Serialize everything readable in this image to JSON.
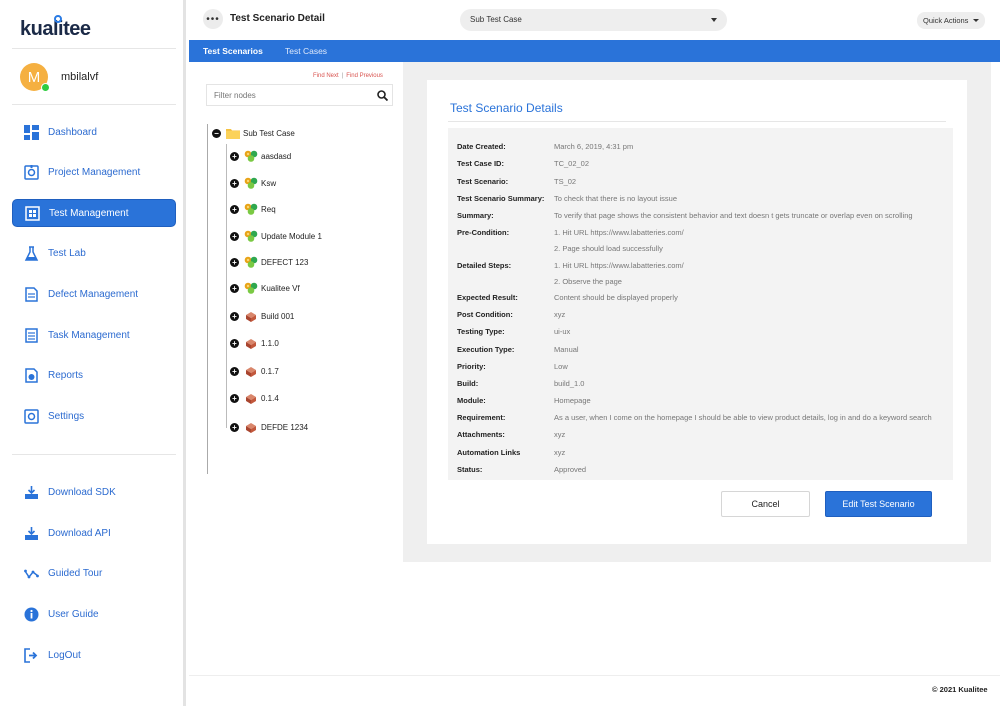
{
  "brand": {
    "logo_text": "kualitee",
    "accent": "#2a73d9"
  },
  "user": {
    "initial": "M",
    "name": "mbilalvf"
  },
  "sidebar": {
    "items": [
      {
        "label": "Dashboard",
        "icon": "dashboard-icon"
      },
      {
        "label": "Project Management",
        "icon": "project-icon"
      },
      {
        "label": "Test Management",
        "icon": "test-management-icon",
        "active": true
      },
      {
        "label": "Test Lab",
        "icon": "flask-icon"
      },
      {
        "label": "Defect Management",
        "icon": "defect-icon"
      },
      {
        "label": "Task Management",
        "icon": "task-icon"
      },
      {
        "label": "Reports",
        "icon": "reports-icon"
      },
      {
        "label": "Settings",
        "icon": "settings-icon"
      }
    ],
    "secondary": [
      {
        "label": "Download SDK",
        "icon": "download-sdk-icon"
      },
      {
        "label": "Download API",
        "icon": "download-api-icon"
      },
      {
        "label": "Guided Tour",
        "icon": "tour-icon"
      },
      {
        "label": "User Guide",
        "icon": "info-icon"
      },
      {
        "label": "LogOut",
        "icon": "logout-icon"
      }
    ]
  },
  "header": {
    "menu_glyph": "•••",
    "title": "Test Scenario Detail",
    "selector_value": "Sub Test Case",
    "quick_actions": "Quick Actions"
  },
  "tabs": [
    {
      "label": "Test Scenarios",
      "active": true
    },
    {
      "label": "Test Cases",
      "active": false
    }
  ],
  "tree": {
    "find_next": "Find Next",
    "find_prev": "Find Previous",
    "filter_placeholder": "Filter nodes",
    "root": "Sub Test Case",
    "nodes": [
      {
        "label": "aasdasd",
        "kind": "module"
      },
      {
        "label": "Ksw",
        "kind": "module"
      },
      {
        "label": "Req",
        "kind": "module"
      },
      {
        "label": "Update Module 1",
        "kind": "module"
      },
      {
        "label": "DEFECT 123",
        "kind": "module"
      },
      {
        "label": "Kualitee Vf",
        "kind": "module"
      },
      {
        "label": "Build 001",
        "kind": "build"
      },
      {
        "label": "1.1.0",
        "kind": "build"
      },
      {
        "label": "0.1.7",
        "kind": "build"
      },
      {
        "label": "0.1.4",
        "kind": "build"
      },
      {
        "label": "DEFDE 1234",
        "kind": "build"
      }
    ]
  },
  "details": {
    "title": "Test Scenario Details",
    "rows": [
      {
        "label": "Date Created:",
        "value": "March 6, 2019, 4:31 pm"
      },
      {
        "label": "Test Case ID:",
        "value": "TC_02_02"
      },
      {
        "label": "Test Scenario:",
        "value": "TS_02"
      },
      {
        "label": "Test Scenario Summary:",
        "value": "To check that there is no layout issue"
      },
      {
        "label": "Summary:",
        "value": "To verify that page shows the consistent behavior and text doesn t gets truncate or overlap even on scrolling"
      },
      {
        "label": "Pre-Condition:",
        "value": "1. Hit URL https://www.labatteries.com/",
        "value2": "2. Page should load successfully"
      },
      {
        "label": "Detailed Steps:",
        "value": "1. Hit URL https://www.labatteries.com/",
        "value2": "2. Observe the page"
      },
      {
        "label": "Expected Result:",
        "value": "Content should be displayed properly"
      },
      {
        "label": "Post Condition:",
        "value": "xyz"
      },
      {
        "label": "Testing Type:",
        "value": "ui-ux"
      },
      {
        "label": "Execution Type:",
        "value": "Manual"
      },
      {
        "label": "Priority:",
        "value": "Low"
      },
      {
        "label": "Build:",
        "value": "build_1.0"
      },
      {
        "label": "Module:",
        "value": "Homepage"
      },
      {
        "label": "Requirement:",
        "value": "As a user, when I come on the homepage I should be able to view product details, log in and do a keyword search"
      },
      {
        "label": "Attachments:",
        "value": "xyz"
      },
      {
        "label": "Automation Links",
        "value": "xyz"
      },
      {
        "label": "Status:",
        "value": "Approved"
      }
    ],
    "cancel_label": "Cancel",
    "edit_label": "Edit Test Scenario"
  },
  "footer": {
    "copyright": "© 2021 Kualitee"
  }
}
